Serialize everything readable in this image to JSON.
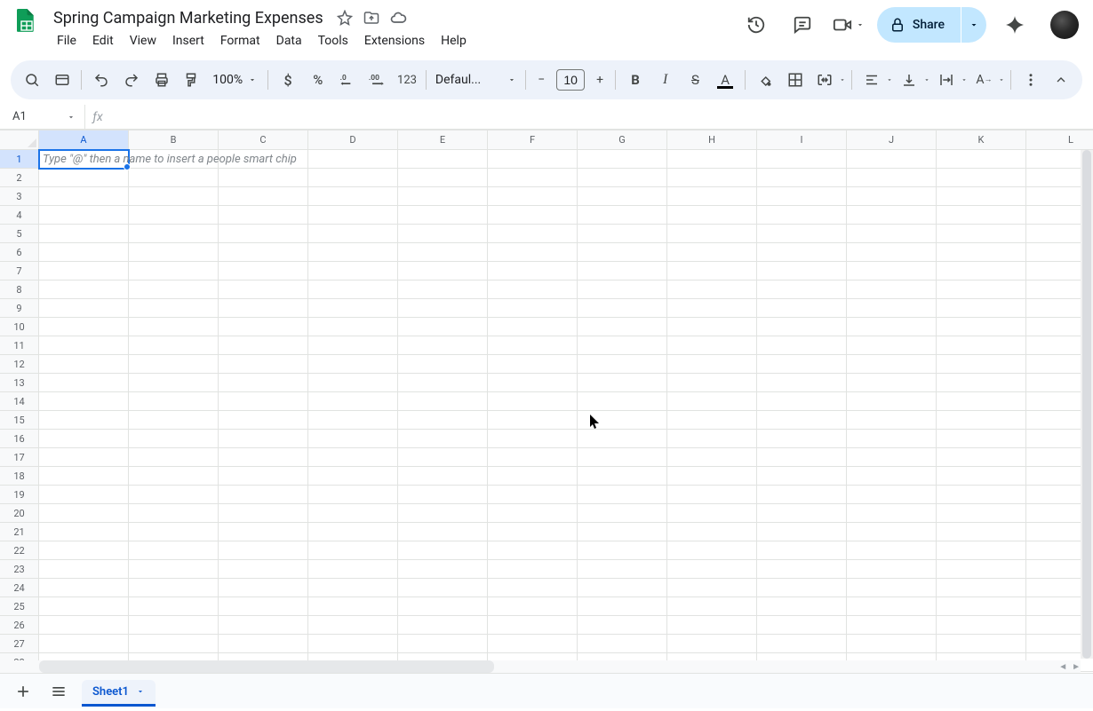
{
  "header": {
    "doc_title": "Spring Campaign Marketing Expenses",
    "menus": [
      "File",
      "Edit",
      "View",
      "Insert",
      "Format",
      "Data",
      "Tools",
      "Extensions",
      "Help"
    ],
    "share_label": "Share"
  },
  "toolbar": {
    "zoom": "100%",
    "font_name": "Defaul...",
    "font_size": "10",
    "number_format_label": "123"
  },
  "namebox": {
    "value": "A1"
  },
  "formula_bar": {
    "value": ""
  },
  "grid": {
    "columns": [
      "A",
      "B",
      "C",
      "D",
      "E",
      "F",
      "G",
      "H",
      "I",
      "J",
      "K",
      "L"
    ],
    "rows": 28,
    "selected_col": "A",
    "selected_row": 1,
    "a1_placeholder": "Type \"@\" then a name to insert a people smart chip"
  },
  "sheetbar": {
    "active_tab": "Sheet1"
  }
}
